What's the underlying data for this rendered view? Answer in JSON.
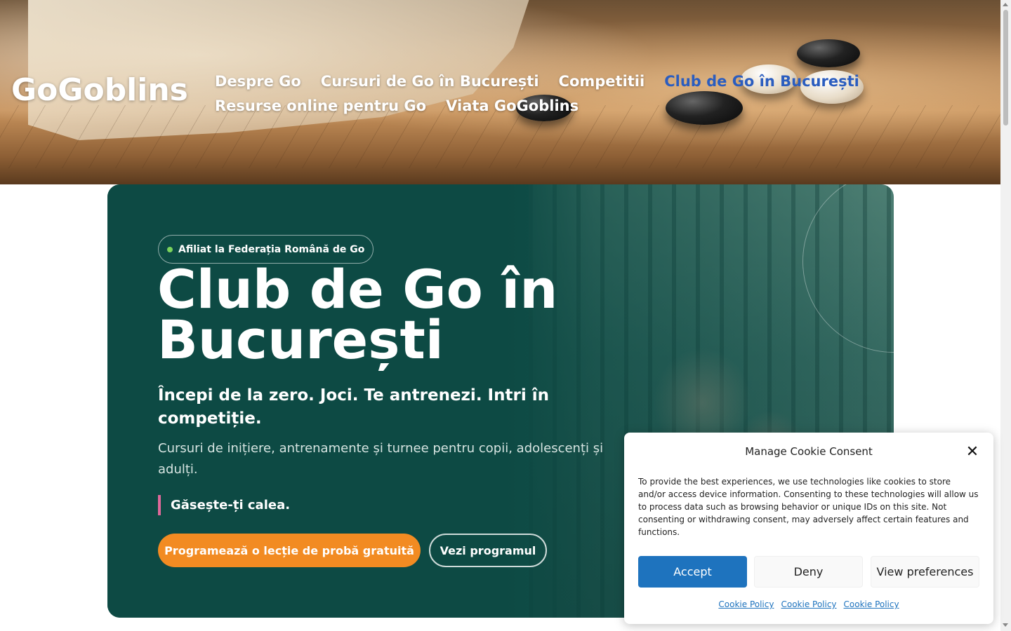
{
  "site": {
    "title": "GoGoblins"
  },
  "nav": {
    "row1": [
      "Despre Go",
      "Cursuri de Go în București",
      "Competitii",
      "Club de Go în București"
    ],
    "row2": [
      "Resurse online pentru Go",
      "Viata GoGoblins"
    ],
    "active": "Club de Go în București"
  },
  "hero": {
    "badge": "Afiliat la Federația Română de Go",
    "title": "Club de Go în București",
    "subtitle": "Începi de la zero. Joci. Te antrenezi. Intri în competiție.",
    "description": "Cursuri de inițiere, antrenamente și turnee pentru copii, adolescenți și adulți.",
    "tagline": "Găsește-ți calea.",
    "primary_button": "Programează o lecție de probă gratuită",
    "secondary_button": "Vezi programul"
  },
  "cookie": {
    "title": "Manage Cookie Consent",
    "body": "To provide the best experiences, we use technologies like cookies to store and/or access device information. Consenting to these technologies will allow us to process data such as browsing behavior or unique IDs on this site. Not consenting or withdrawing consent, may adversely affect certain features and functions.",
    "accept": "Accept",
    "deny": "Deny",
    "preferences": "View preferences",
    "links": [
      "Cookie Policy",
      "Cookie Policy",
      "Cookie Policy"
    ],
    "close_symbol": "✕"
  },
  "colors": {
    "hero_bg": "#0d4a44",
    "accent_orange": "#f28b22",
    "nav_active": "#2b5dbf",
    "cookie_accept": "#1e73be",
    "tagline_bar": "#e0689a",
    "badge_dot": "#7bd35c"
  }
}
